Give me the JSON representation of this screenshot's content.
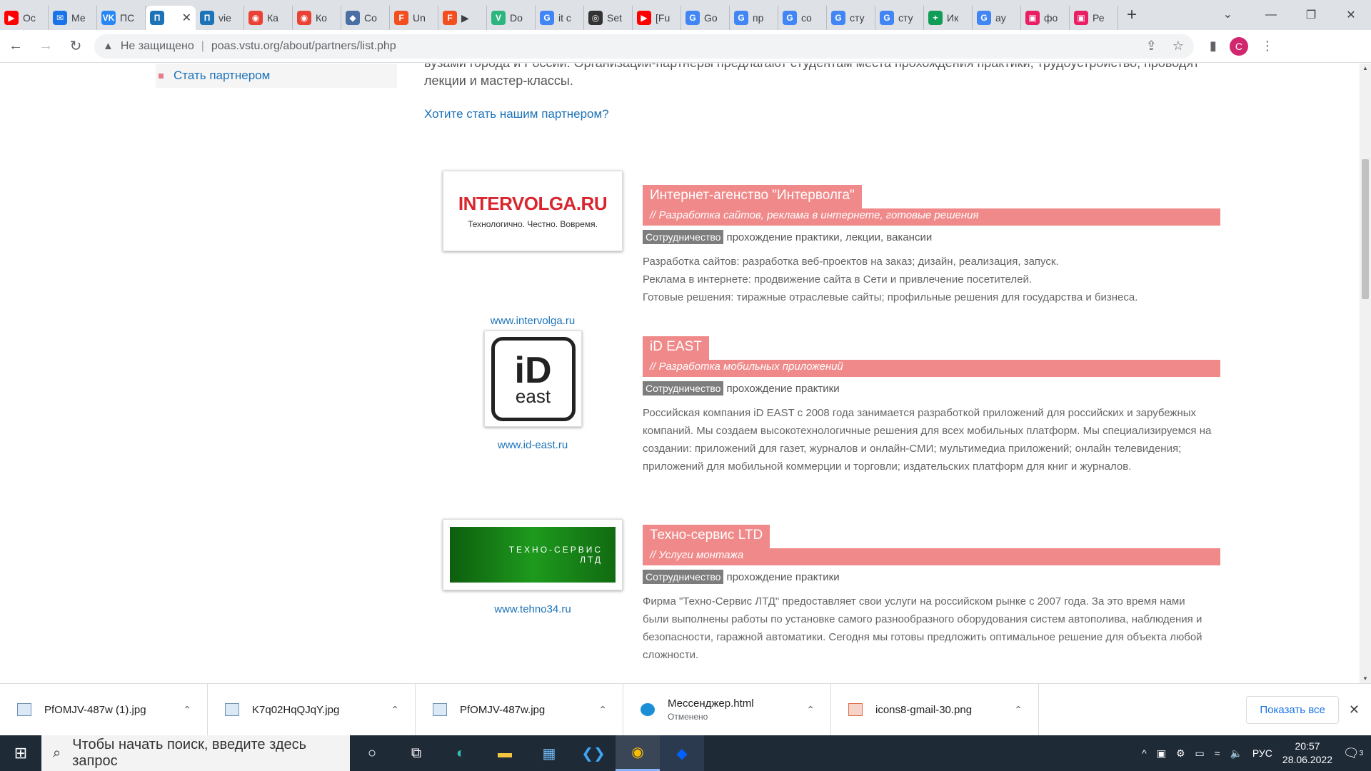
{
  "browser": {
    "tabs": [
      {
        "label": "Ос",
        "color": "#ff0000",
        "glyph": "▶"
      },
      {
        "label": "Ме",
        "color": "#1a73e8",
        "glyph": "✉"
      },
      {
        "label": "ПС",
        "color": "#2787f5",
        "glyph": "VK"
      },
      {
        "label": "",
        "color": "#1d73b8",
        "glyph": "П",
        "active": true
      },
      {
        "label": "vie",
        "color": "#1d73b8",
        "glyph": "П"
      },
      {
        "label": "Ка",
        "color": "#ea4335",
        "glyph": "◉"
      },
      {
        "label": "Ко",
        "color": "#ea4335",
        "glyph": "◉"
      },
      {
        "label": "Co",
        "color": "#4a6fa5",
        "glyph": "◆"
      },
      {
        "label": "Un",
        "color": "#f24e1e",
        "glyph": "F"
      },
      {
        "label": "▶",
        "color": "#f24e1e",
        "glyph": "F"
      },
      {
        "label": "Do",
        "color": "#2cb57c",
        "glyph": "V"
      },
      {
        "label": "it c",
        "color": "#4285f4",
        "glyph": "G"
      },
      {
        "label": "Set",
        "color": "#333333",
        "glyph": "◎"
      },
      {
        "label": "[Fu",
        "color": "#ff0000",
        "glyph": "▶"
      },
      {
        "label": "Go",
        "color": "#4285f4",
        "glyph": "G"
      },
      {
        "label": "пр",
        "color": "#4285f4",
        "glyph": "G"
      },
      {
        "label": "co",
        "color": "#4285f4",
        "glyph": "G"
      },
      {
        "label": "сту",
        "color": "#4285f4",
        "glyph": "G"
      },
      {
        "label": "сту",
        "color": "#4285f4",
        "glyph": "G"
      },
      {
        "label": "Ик",
        "color": "#0f9d58",
        "glyph": "+"
      },
      {
        "label": "ay",
        "color": "#4285f4",
        "glyph": "G"
      },
      {
        "label": "фо",
        "color": "#e91e63",
        "glyph": "▣"
      },
      {
        "label": "Ре",
        "color": "#e91e63",
        "glyph": "▣"
      }
    ],
    "new_tab": "+",
    "address": {
      "insecure_label": "Не защищено",
      "url": "poas.vstu.org/about/partners/list.php"
    },
    "profile_initial": "C"
  },
  "page": {
    "sidebar_link": "Стать партнером",
    "intro_text": "вузами города и России. Организации-партнеры предлагают студентам места прохождения практики, трудоустройство, проводят лекции и мастер-классы.",
    "cta_link": "Хотите стать нашим партнером?",
    "partners": [
      {
        "name": "Интернет-агенство \"Интерволга\"",
        "tagline": "// Разработка сайтов, реклама в интернете, готовые решения",
        "tag": "Сотрудничество",
        "cooperation": "прохождение практики, лекции, вакансии",
        "website": "www.intervolga.ru",
        "logo_text": "INTERVOLGA.RU",
        "logo_subtext": "Технологично. Честно. Вовремя.",
        "description": [
          "Разработка сайтов: разработка веб-проектов на заказ; дизайн, реализация, запуск.",
          "Реклама в интернете: продвижение сайта в Сети и привлечение посетителей.",
          "Готовые решения: тиражные отраслевые сайты; профильные решения для государства и бизнеса."
        ]
      },
      {
        "name": "iD EAST",
        "tagline": "// Разработка мобильных приложений",
        "tag": "Сотрудничество",
        "cooperation": "прохождение практики",
        "website": "www.id-east.ru",
        "logo_text": "iD",
        "logo_subtext": "east",
        "description": [
          "Российская компания iD EAST с 2008 года занимается разработкой приложений для российских и зарубежных компаний. Мы создаем высокотехнологичные решения для всех мобильных платформ. Мы специализируемся на создании: приложений для газет, журналов и онлайн-СМИ; мультимедиа приложений; онлайн телевидения; приложений для мобильной коммерции и торговли; издательских платформ для книг и журналов."
        ]
      },
      {
        "name": "Техно-сервис LTD",
        "tagline": "// Услуги монтажа",
        "tag": "Сотрудничество",
        "cooperation": "прохождение практики",
        "website": "www.tehno34.ru",
        "logo_text": "ТЕХНО-СЕРВИС",
        "logo_subtext": "ЛТД",
        "description": [
          "Фирма \"Техно-Сервис ЛТД\" предоставляет свои услуги на российском рынке с 2007 года. За это время нами были выполнены работы по установке самого разнообразного оборудования систем автополива, наблюдения и безопасности, гаражной автоматики. Сегодня мы готовы предложить оптимальное решение для объекта любой сложности."
        ]
      }
    ]
  },
  "downloads": {
    "items": [
      {
        "name": "PfOMJV-487w (1).jpg",
        "status": ""
      },
      {
        "name": "K7q02HqQJqY.jpg",
        "status": ""
      },
      {
        "name": "PfOMJV-487w.jpg",
        "status": ""
      },
      {
        "name": "Мессенджер.html",
        "status": "Отменено"
      },
      {
        "name": "icons8-gmail-30.png",
        "status": ""
      }
    ],
    "show_all": "Показать все"
  },
  "taskbar": {
    "search_placeholder": "Чтобы начать поиск, введите здесь запрос",
    "language": "РУС",
    "time": "20:57",
    "date": "28.06.2022",
    "notification_count": "3"
  }
}
